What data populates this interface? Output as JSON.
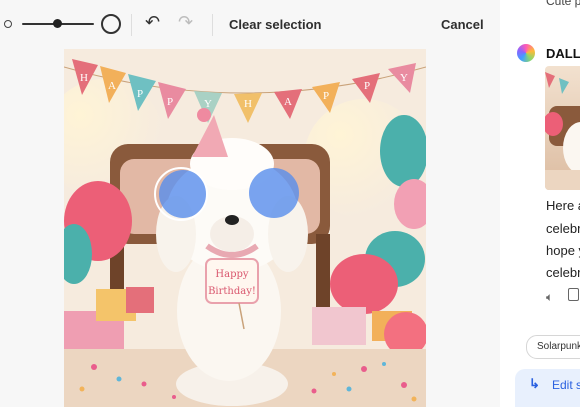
{
  "toolbar": {
    "brush_small_icon": "brush-size-small-icon",
    "brush_size_slider_value": 0.45,
    "brush_large_icon": "brush-size-large-icon",
    "undo_icon": "undo-icon",
    "redo_icon": "redo-icon",
    "clear_label": "Clear selection",
    "cancel_label": "Cancel"
  },
  "canvas": {
    "bunting": [
      "H",
      "A",
      "P",
      "P",
      "Y",
      "H",
      "A",
      "P",
      "P",
      "Y"
    ],
    "sign_line1": "Happy",
    "sign_line2": "Birthday!",
    "selection_count": 2,
    "selection_color": "#578dec"
  },
  "chat": {
    "top_partial": "Cute p",
    "sender": "DALL-",
    "message_lines": [
      "Here a",
      "celebr",
      "hope y",
      "celebr"
    ],
    "actions": [
      "speaker-icon",
      "copy-icon"
    ],
    "style_chip": "Solarpunk",
    "edit_label": "Edit s",
    "edit_icon": "return-arrow-icon"
  },
  "colors": {
    "accent": "#2b61e0",
    "mask": "#578dec"
  }
}
